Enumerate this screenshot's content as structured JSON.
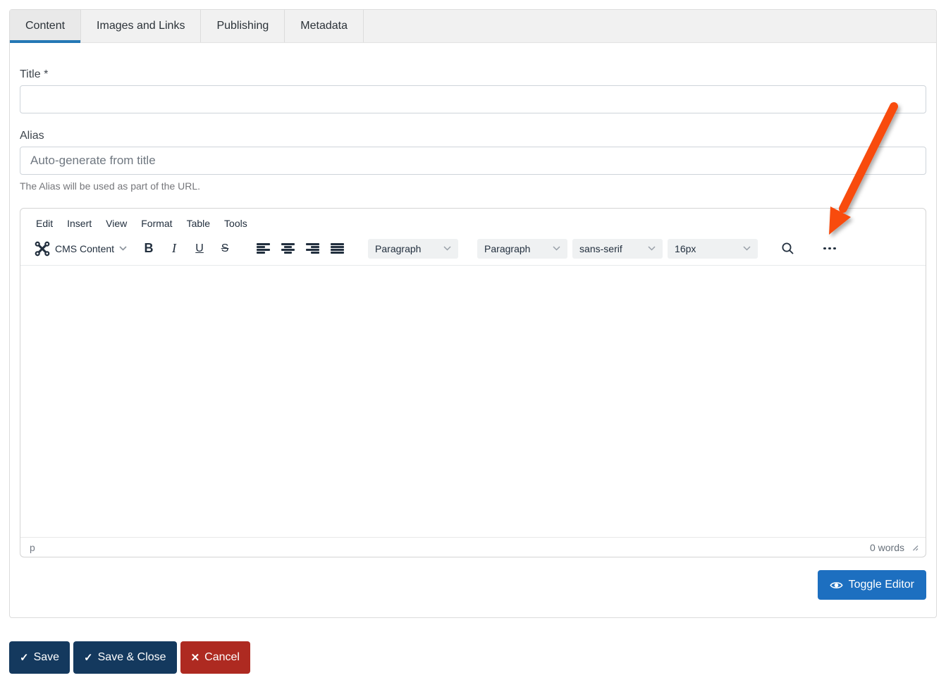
{
  "tabs": {
    "items": [
      {
        "label": "Content",
        "active": true
      },
      {
        "label": "Images and Links",
        "active": false
      },
      {
        "label": "Publishing",
        "active": false
      },
      {
        "label": "Metadata",
        "active": false
      }
    ]
  },
  "form": {
    "title_label": "Title *",
    "title_value": "",
    "alias_label": "Alias",
    "alias_placeholder": "Auto-generate from title",
    "alias_hint": "The Alias will be used as part of the URL."
  },
  "editor": {
    "menu_items": [
      "Edit",
      "Insert",
      "View",
      "Format",
      "Table",
      "Tools"
    ],
    "toolbar": {
      "cms_button_label": "CMS Content",
      "bold_label": "B",
      "italic_label": "I",
      "underline_label": "U",
      "strikethrough_label": "S",
      "style_select_value": "Paragraph",
      "block_select_value": "Paragraph",
      "font_select_value": "sans-serif",
      "fontsize_select_value": "16px"
    },
    "statusbar": {
      "element_path": "p",
      "word_count": "0 words"
    }
  },
  "buttons": {
    "toggle_editor": "Toggle Editor",
    "save": "Save",
    "save_close": "Save & Close",
    "cancel": "Cancel",
    "check_icon_glyph": "✓",
    "cancel_icon_glyph": "✕"
  },
  "icons": {
    "cms_logo": "joomla-logo-icon",
    "search": "magnifier-icon",
    "more": "ellipsis-icon",
    "toggle": "eye-icon",
    "resize": "drag-grip-icon"
  },
  "colors": {
    "tab_accent_blue": "#2478b5",
    "toggle_button_blue": "#1d6fc0",
    "save_button_navy": "#14395e",
    "cancel_button_red": "#ae2a21",
    "arrow_orange": "#f84b0c",
    "toolbar_icon_navy": "#222f3e"
  }
}
